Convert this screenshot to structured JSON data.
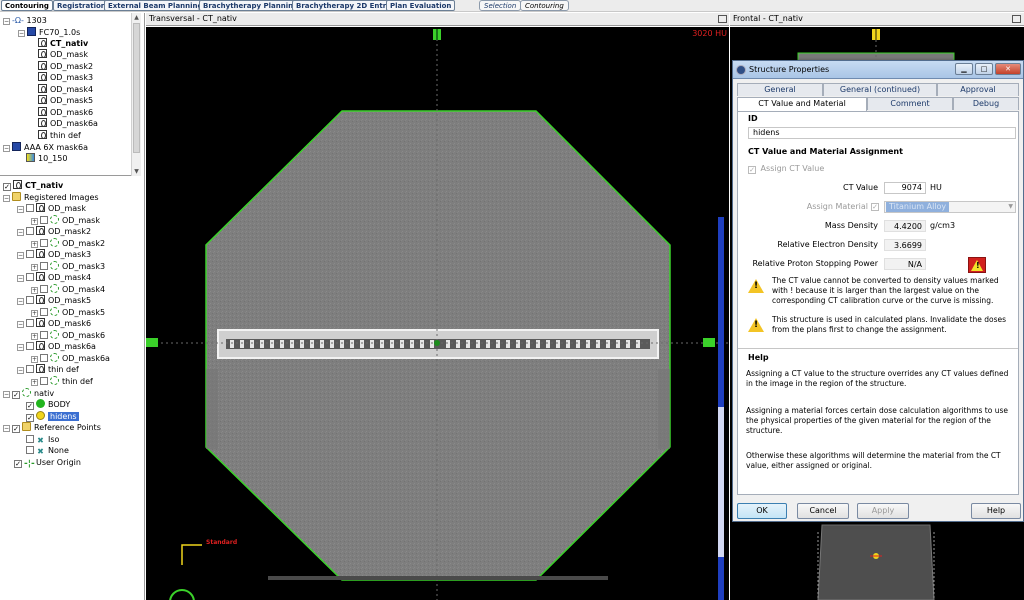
{
  "workspace_tabs": [
    {
      "label": "Contouring",
      "active": true
    },
    {
      "label": "Registration",
      "active": false
    },
    {
      "label": "External Beam Planning",
      "active": false
    },
    {
      "label": "Brachytherapy Planning",
      "active": false
    },
    {
      "label": "Brachytherapy 2D Entry",
      "active": false
    },
    {
      "label": "Plan Evaluation",
      "active": false
    }
  ],
  "mode_tabs": [
    {
      "label": "Selection",
      "active": false
    },
    {
      "label": "Contouring",
      "active": true
    }
  ],
  "upper_tree": [
    "1303",
    "FC70_1.0s",
    "CT_nativ",
    "OD_mask",
    "OD_mask2",
    "OD_mask3",
    "OD_mask4",
    "OD_mask5",
    "OD_mask6",
    "OD_mask6a",
    "thin def",
    "AAA 6X mask6a",
    "10_150"
  ],
  "lower_tree": {
    "root": "CT_nativ",
    "registered_images": "Registered Images",
    "images": [
      {
        "name": "OD_mask",
        "child": "OD_mask"
      },
      {
        "name": "OD_mask2",
        "child": "OD_mask2"
      },
      {
        "name": "OD_mask3",
        "child": "OD_mask3"
      },
      {
        "name": "OD_mask4",
        "child": "OD_mask4"
      },
      {
        "name": "OD_mask5",
        "child": "OD_mask5"
      },
      {
        "name": "OD_mask6",
        "child": "OD_mask6"
      },
      {
        "name": "OD_mask6a",
        "child": "OD_mask6a"
      },
      {
        "name": "thin def",
        "child": "thin def"
      }
    ],
    "structure_set": "nativ",
    "structures": [
      "BODY",
      "hidens"
    ],
    "reference_points": "Reference Points",
    "points": [
      "Iso",
      "None"
    ],
    "user_origin": "User Origin"
  },
  "transversal": {
    "title": "Transversal - CT_nativ",
    "hu_readout": "3020 HU",
    "standard_label": "Standard"
  },
  "frontal": {
    "title": "Frontal - CT_nativ"
  },
  "dialog": {
    "title": "Structure Properties",
    "tabs_row1": [
      "General",
      "General (continued)",
      "Approval"
    ],
    "tabs_row2": [
      "CT Value and Material",
      "Comment",
      "Debug"
    ],
    "active_tab": "CT Value and Material",
    "id_section": "ID",
    "id_value": "hidens",
    "assignment_section": "CT Value and Material Assignment",
    "assign_ct_value": "Assign CT Value",
    "ct_value_label": "CT Value",
    "ct_value": "9074",
    "ct_unit": "HU",
    "assign_material_label": "Assign Material",
    "material_value": "Titanium Alloy",
    "mass_density_label": "Mass Density",
    "mass_density": "4.4200",
    "mass_density_unit": "g/cm3",
    "red_label": "Relative Electron Density",
    "red_value": "3.6699",
    "rpsp_label": "Relative Proton Stopping Power",
    "rpsp_value": "N/A",
    "warning1": "The CT value cannot be converted to density values marked with ! because it is larger than the largest value on the corresponding CT calibration curve or the curve is missing.",
    "warning2": "This structure is used in calculated plans. Invalidate the doses from the plans first to change the assignment.",
    "help_section": "Help",
    "help1": "Assigning a CT value to the structure overrides any CT values defined in the image in the region of the structure.",
    "help2": "Assigning a material forces certain dose calculation algorithms to use the physical properties of the given material for the region of the structure.",
    "help3": "Otherwise these algorithms will determine the material from the CT value, either assigned or original.",
    "ok": "OK",
    "cancel": "Cancel",
    "apply": "Apply",
    "help_btn": "Help"
  },
  "colors": {
    "contour_green": "#22b51e",
    "hu_red": "#e02020",
    "selection_blue": "#3b6fd1"
  }
}
